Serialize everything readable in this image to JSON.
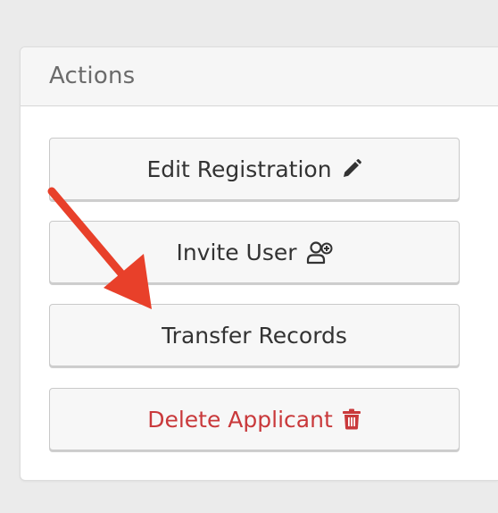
{
  "panel": {
    "title": "Actions"
  },
  "actions": [
    {
      "label": "Edit Registration",
      "icon": "pencil-icon"
    },
    {
      "label": "Invite User",
      "icon": "user-plus-icon"
    },
    {
      "label": "Transfer Records",
      "icon": ""
    },
    {
      "label": "Delete Applicant",
      "icon": "trash-icon"
    }
  ],
  "colors": {
    "danger": "#c9393b",
    "annotation_arrow": "#e8402a"
  }
}
